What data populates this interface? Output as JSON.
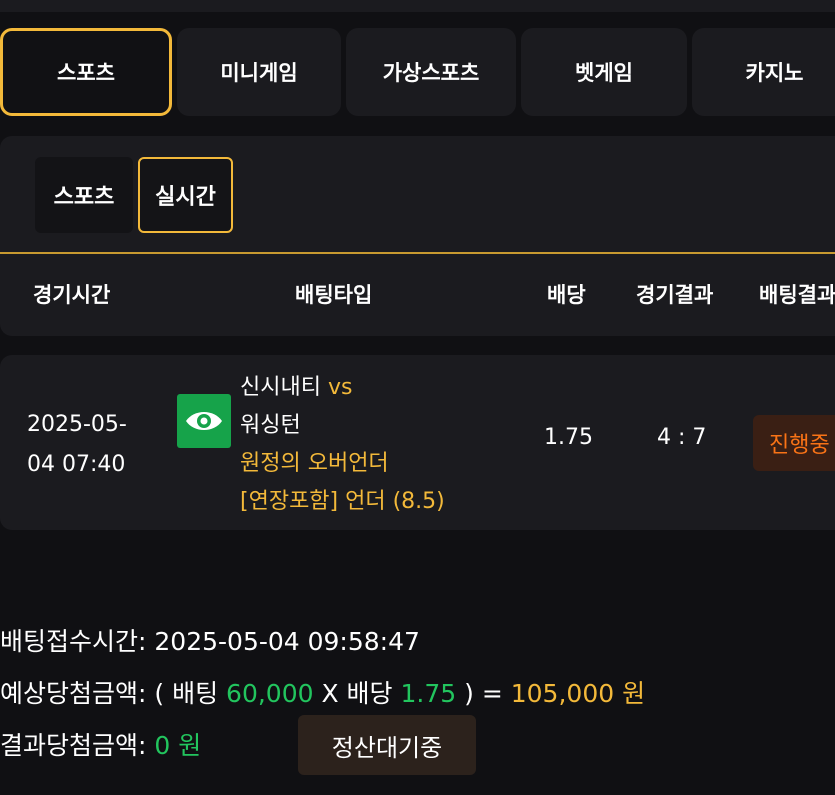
{
  "tabs": [
    {
      "label": "스포츠",
      "active": true
    },
    {
      "label": "미니게임"
    },
    {
      "label": "가상스포츠"
    },
    {
      "label": "벳게임"
    },
    {
      "label": "카지노"
    }
  ],
  "subtabs": [
    {
      "label": "스포츠"
    },
    {
      "label": "실시간",
      "active": true
    }
  ],
  "table": {
    "headers": [
      "경기시간",
      "배팅타입",
      "배당",
      "경기결과",
      "배팅결과"
    ],
    "row": {
      "datetime_line1": "2025-05-",
      "datetime_line2": "04 07:40",
      "icon": "eye-icon",
      "team_home": "신시내티",
      "vs": "vs",
      "team_away": "워싱턴",
      "bet_type": "원정의 오버언더",
      "bet_detail": "[연장포함] 언더 (8.5)",
      "odds": "1.75",
      "score": "4 : 7",
      "status": "진행중"
    }
  },
  "summary": {
    "received_label": "배팅접수시간:",
    "received_value": "2025-05-04 09:58:47",
    "expected_label": "예상당첨금액:",
    "expected_open": "( 배팅",
    "bet_amount": "60,000",
    "x_odds": "X 배당",
    "odds": "1.75",
    "expected_close": ") =",
    "expected_total": "105,000 원",
    "result_label": "결과당첨금액:",
    "result_value": "0 원",
    "wait_button": "정산대기중"
  },
  "colors": {
    "accent": "#f3b93a",
    "green": "#22c55e",
    "orange": "#f97316",
    "bg": "#101013",
    "panel": "#1b1b1f"
  }
}
